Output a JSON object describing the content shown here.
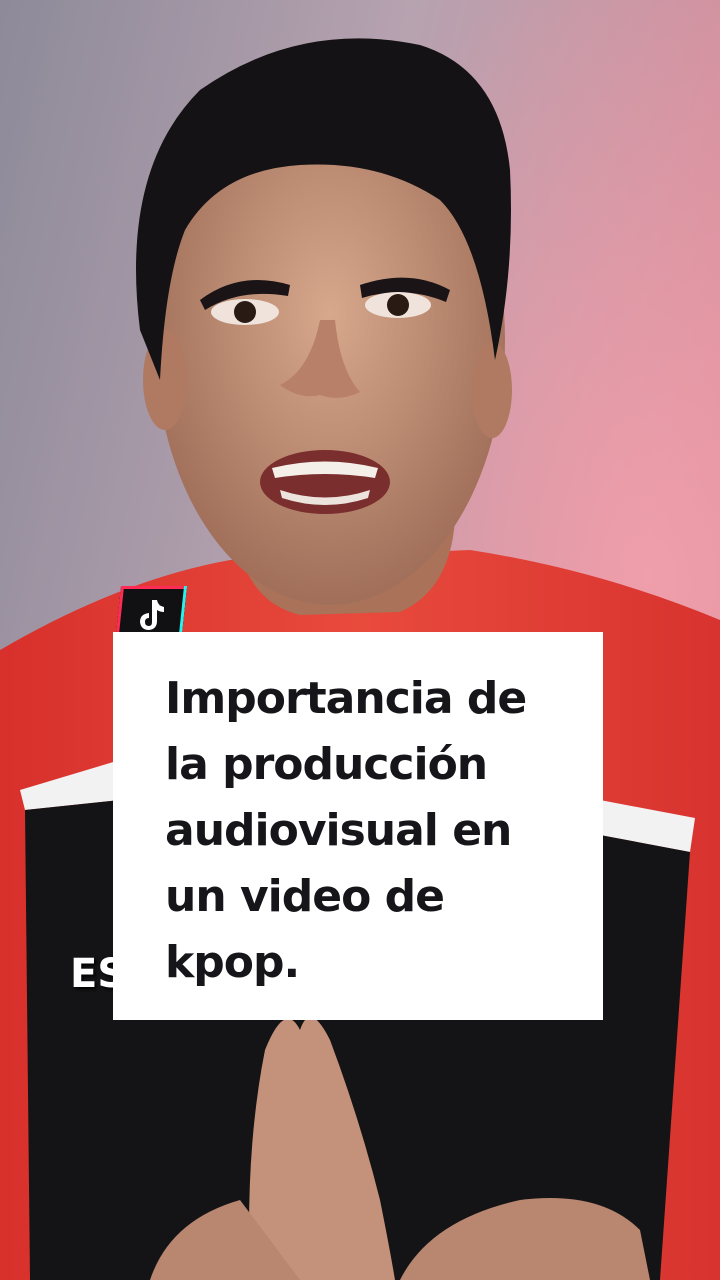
{
  "overlay": {
    "title_lines": [
      "Importancia de",
      "la producción",
      "audiovisual en",
      "un video de",
      "kpop."
    ],
    "partial_caption": "ES",
    "badge_icon": "tiktok-logo-icon"
  },
  "colors": {
    "card_background": "#ffffff",
    "title_text": "#16161a",
    "badge_background": "#111114",
    "shirt_red": "#e23a36"
  }
}
